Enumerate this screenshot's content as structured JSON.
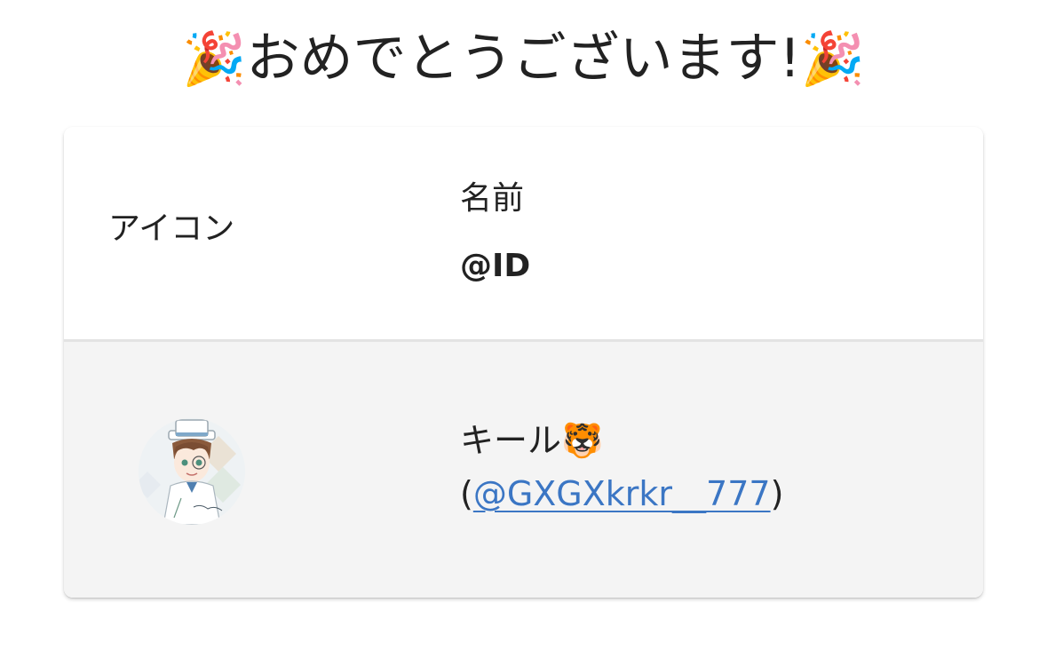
{
  "header": {
    "emoji_left": "🎉",
    "title": "おめでとうございます!",
    "emoji_right": "🎉"
  },
  "table": {
    "columns": {
      "icon": "アイコン",
      "name": "名前",
      "id": "@ID"
    },
    "rows": [
      {
        "name": "キール🐯",
        "handle_prefix": "(",
        "handle": "@GXGXkrkr__777",
        "handle_suffix": ")",
        "avatar": "avatar-illustration"
      }
    ]
  },
  "colors": {
    "link": "#3b76c4",
    "row_background": "#f4f4f4",
    "divider": "#e3e3e3"
  }
}
